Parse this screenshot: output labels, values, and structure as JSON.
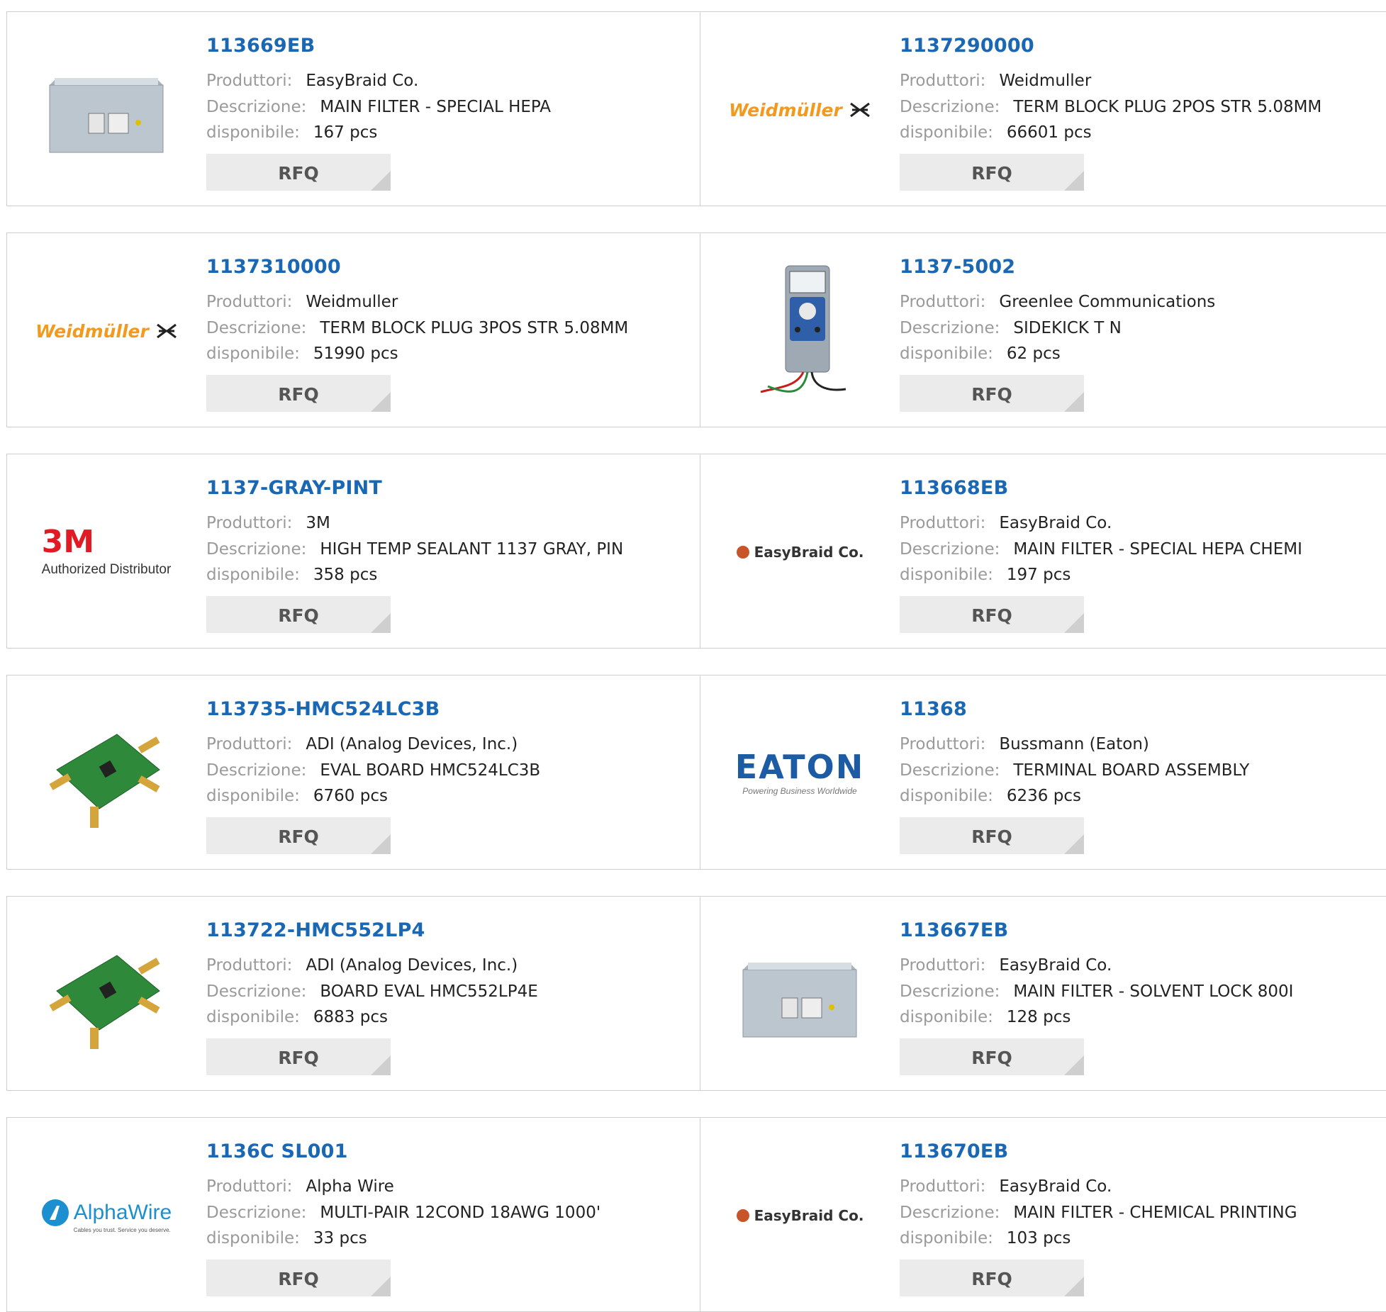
{
  "labels": {
    "manufacturer": "Produttori:",
    "description": "Descrizione:",
    "available": "disponibile:",
    "rfq": "RFQ"
  },
  "products": [
    {
      "part": "113669EB",
      "manufacturer": "EasyBraid Co.",
      "description": "MAIN FILTER - SPECIAL HEPA",
      "available": "167 pcs",
      "image": "filter-box-icon"
    },
    {
      "part": "1137290000",
      "manufacturer": "Weidmuller",
      "description": "TERM BLOCK PLUG 2POS STR 5.08MM",
      "available": "66601 pcs",
      "image": "weidmuller-logo",
      "logo_text": "Weidmüller"
    },
    {
      "part": "1137310000",
      "manufacturer": "Weidmuller",
      "description": "TERM BLOCK PLUG 3POS STR 5.08MM",
      "available": "51990 pcs",
      "image": "weidmuller-logo",
      "logo_text": "Weidmüller"
    },
    {
      "part": "1137-5002",
      "manufacturer": "Greenlee Communications",
      "description": "SIDEKICK T N",
      "available": "62 pcs",
      "image": "test-meter-icon"
    },
    {
      "part": "1137-GRAY-PINT",
      "manufacturer": "3M",
      "description": "HIGH TEMP SEALANT 1137 GRAY, PIN",
      "available": "358 pcs",
      "image": "3m-logo",
      "logo_text": "3M",
      "logo_sub": "Authorized Distributor"
    },
    {
      "part": "113668EB",
      "manufacturer": "EasyBraid Co.",
      "description": "MAIN FILTER - SPECIAL HEPA CHEMI",
      "available": "197 pcs",
      "image": "easybraid-logo",
      "logo_text": "EasyBraid Co."
    },
    {
      "part": "113735-HMC524LC3B",
      "manufacturer": "ADI (Analog Devices, Inc.)",
      "description": "EVAL BOARD HMC524LC3B",
      "available": "6760 pcs",
      "image": "eval-board-icon"
    },
    {
      "part": "11368",
      "manufacturer": "Bussmann (Eaton)",
      "description": "TERMINAL BOARD ASSEMBLY",
      "available": "6236 pcs",
      "image": "eaton-logo",
      "logo_text": "EATON",
      "logo_sub": "Powering Business Worldwide"
    },
    {
      "part": "113722-HMC552LP4",
      "manufacturer": "ADI (Analog Devices, Inc.)",
      "description": "BOARD EVAL HMC552LP4E",
      "available": "6883 pcs",
      "image": "eval-board-icon"
    },
    {
      "part": "113667EB",
      "manufacturer": "EasyBraid Co.",
      "description": "MAIN FILTER - SOLVENT LOCK 800I",
      "available": "128 pcs",
      "image": "filter-box-icon"
    },
    {
      "part": "1136C SL001",
      "manufacturer": "Alpha Wire",
      "description": "MULTI-PAIR 12COND 18AWG 1000'",
      "available": "33 pcs",
      "image": "alphawire-logo",
      "logo_text": "AlphaWire",
      "logo_sub": "Cables you trust. Service you deserve."
    },
    {
      "part": "113670EB",
      "manufacturer": "EasyBraid Co.",
      "description": "MAIN FILTER - CHEMICAL PRINTING",
      "available": "103 pcs",
      "image": "easybraid-logo",
      "logo_text": "EasyBraid Co."
    }
  ],
  "colors": {
    "part_link": "#1a68b4",
    "label_grey": "#9a9a9a",
    "rfq_bg": "#ebebeb",
    "weidmuller_orange": "#f39a1e",
    "threem_red": "#e21a23",
    "eaton_blue": "#1d5ba4",
    "alphawire_blue": "#1c8fd0"
  }
}
